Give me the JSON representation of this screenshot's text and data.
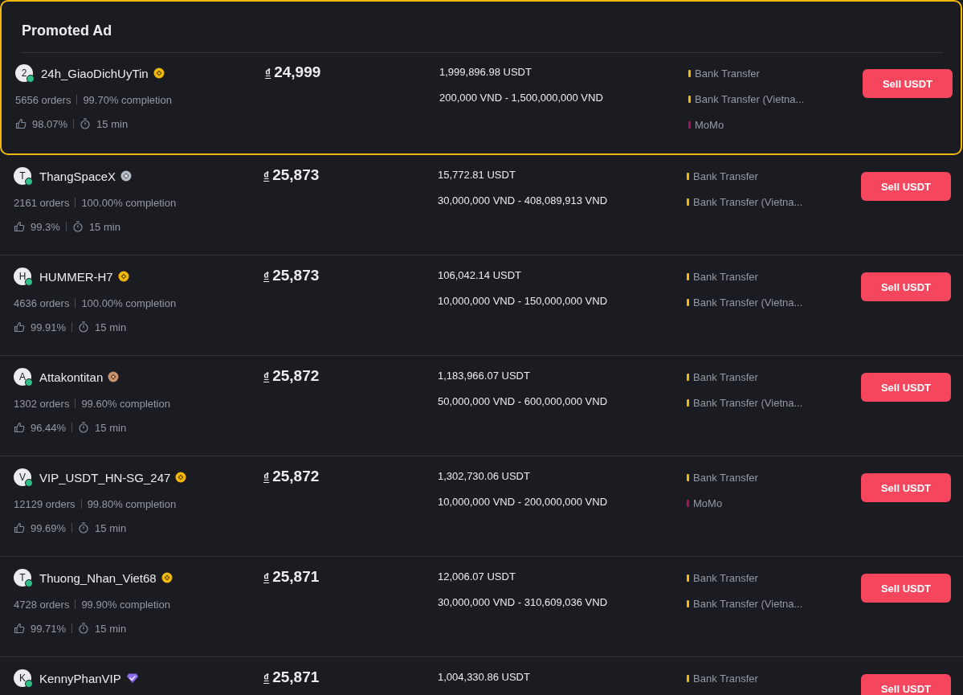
{
  "promoted": {
    "title": "Promoted Ad",
    "ad": {
      "avatar": "2",
      "online": true,
      "name": "24h_GiaoDichUyTin",
      "badge": {
        "kind": "gold"
      },
      "orders": "5656 orders",
      "completion": "99.70% completion",
      "rating": "98.07%",
      "time": "15 min",
      "currency": "₫",
      "price": "24,999",
      "available": "1,999,896.98 USDT",
      "limit": "200,000 VND - 1,500,000,000 VND",
      "payments": [
        {
          "name": "Bank Transfer",
          "color": "#f0b90b"
        },
        {
          "name": "Bank Transfer (Vietna...",
          "color": "#f0b90b"
        },
        {
          "name": "MoMo",
          "color": "#a5135e"
        }
      ],
      "action": "Sell USDT"
    }
  },
  "ads": [
    {
      "avatar": "T",
      "online": true,
      "name": "ThangSpaceX",
      "badge": {
        "kind": "silver"
      },
      "orders": "2161 orders",
      "completion": "100.00% completion",
      "rating": "99.3%",
      "time": "15 min",
      "currency": "₫",
      "price": "25,873",
      "available": "15,772.81 USDT",
      "limit": "30,000,000 VND - 408,089,913 VND",
      "payments": [
        {
          "name": "Bank Transfer",
          "color": "#f0b90b"
        },
        {
          "name": "Bank Transfer (Vietna...",
          "color": "#f0b90b"
        }
      ],
      "action": "Sell USDT"
    },
    {
      "avatar": "H",
      "online": true,
      "name": "HUMMER-H7",
      "badge": {
        "kind": "gold"
      },
      "orders": "4636 orders",
      "completion": "100.00% completion",
      "rating": "99.91%",
      "time": "15 min",
      "currency": "₫",
      "price": "25,873",
      "available": "106,042.14 USDT",
      "limit": "10,000,000 VND - 150,000,000 VND",
      "payments": [
        {
          "name": "Bank Transfer",
          "color": "#f0b90b"
        },
        {
          "name": "Bank Transfer (Vietna...",
          "color": "#f0b90b"
        }
      ],
      "action": "Sell USDT"
    },
    {
      "avatar": "A",
      "online": true,
      "name": "Attakontitan",
      "badge": {
        "kind": "bronze"
      },
      "orders": "1302 orders",
      "completion": "99.60% completion",
      "rating": "96.44%",
      "time": "15 min",
      "currency": "₫",
      "price": "25,872",
      "available": "1,183,966.07 USDT",
      "limit": "50,000,000 VND - 600,000,000 VND",
      "payments": [
        {
          "name": "Bank Transfer",
          "color": "#f0b90b"
        },
        {
          "name": "Bank Transfer (Vietna...",
          "color": "#f0b90b"
        }
      ],
      "action": "Sell USDT"
    },
    {
      "avatar": "V",
      "online": true,
      "name": "VIP_USDT_HN-SG_247",
      "badge": {
        "kind": "gold"
      },
      "orders": "12129 orders",
      "completion": "99.80% completion",
      "rating": "99.69%",
      "time": "15 min",
      "currency": "₫",
      "price": "25,872",
      "available": "1,302,730.06 USDT",
      "limit": "10,000,000 VND - 200,000,000 VND",
      "payments": [
        {
          "name": "Bank Transfer",
          "color": "#f0b90b"
        },
        {
          "name": "MoMo",
          "color": "#a5135e"
        }
      ],
      "action": "Sell USDT"
    },
    {
      "avatar": "T",
      "online": true,
      "name": "Thuong_Nhan_Viet68",
      "badge": {
        "kind": "gold"
      },
      "orders": "4728 orders",
      "completion": "99.90% completion",
      "rating": "99.71%",
      "time": "15 min",
      "currency": "₫",
      "price": "25,871",
      "available": "12,006.07 USDT",
      "limit": "30,000,000 VND - 310,609,036 VND",
      "payments": [
        {
          "name": "Bank Transfer",
          "color": "#f0b90b"
        },
        {
          "name": "Bank Transfer (Vietna...",
          "color": "#f0b90b"
        }
      ],
      "action": "Sell USDT"
    },
    {
      "avatar": "K",
      "online": true,
      "name": "KennyPhanVIP",
      "badge": {
        "kind": "diamond"
      },
      "currency": "₫",
      "price": "25,871",
      "available": "1,004,330.86 USDT",
      "payments": [
        {
          "name": "Bank Transfer",
          "color": "#f0b90b"
        }
      ],
      "action": "Sell USDT"
    }
  ]
}
